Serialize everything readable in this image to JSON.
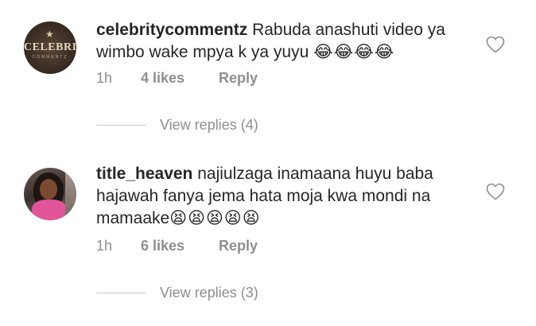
{
  "comments": [
    {
      "username": "celebritycommentz",
      "text": "Rabuda anashuti video ya wimbo wake mpya k ya yuyu",
      "emoji": "😂😂😂😂",
      "time": "1h",
      "likes": "4 likes",
      "reply": "Reply",
      "view_replies": "View replies (4)",
      "avatar": {
        "brand": "CELEBRITY",
        "brand_sub": "COMMENTZ"
      }
    },
    {
      "username": "title_heaven",
      "text": "najiulzaga inamaana huyu baba hajawah fanya jema hata moja kwa mondi na mamaake",
      "emoji": "😫😫😫😫😫",
      "time": "1h",
      "likes": "6 likes",
      "reply": "Reply",
      "view_replies": "View replies (3)"
    }
  ],
  "icons": {
    "like": "heart-outline-icon"
  },
  "colors": {
    "text": "#262626",
    "secondary": "#8e8e8e",
    "divider": "#c7c7c7"
  }
}
